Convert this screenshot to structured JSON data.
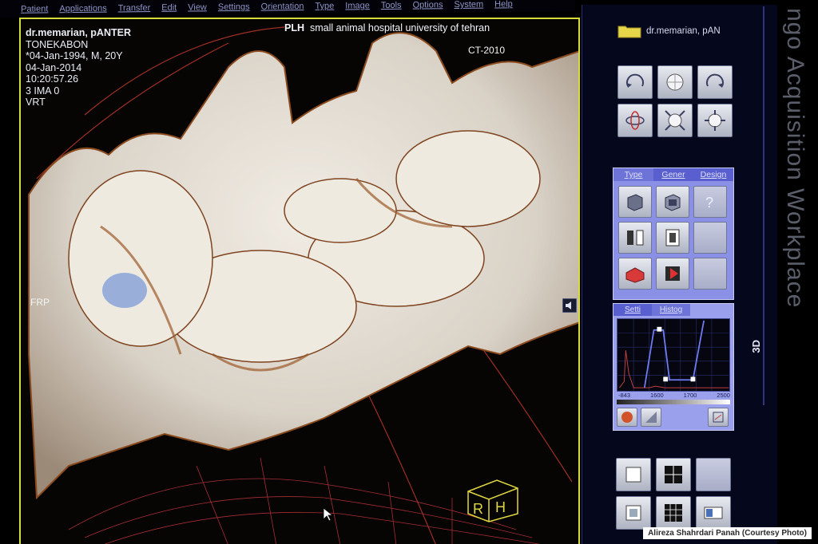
{
  "menu": [
    "Patient",
    "Applications",
    "Transfer",
    "Edit",
    "View",
    "Settings",
    "Orientation",
    "Type",
    "Image",
    "Tools",
    "Options",
    "System",
    "Help"
  ],
  "viewport": {
    "patient_name": "dr.memarian, pANTER",
    "location": "TONEKABON",
    "birth_info": "*04-Jan-1994, M, 20Y",
    "study_date": "04-Jan-2014",
    "study_time": "10:20:57.26",
    "image_info": "3 IMA 0",
    "render_mode": "VRT",
    "orientation_top": "PLH",
    "institution": "small animal hospital university of tehran",
    "scanner": "CT-2010",
    "orientation_left": "FRP",
    "cube_faces": [
      "R",
      "H"
    ]
  },
  "panel": {
    "folder_label": "dr.memarian, pAN",
    "render_tabs": [
      "Type",
      "Gener",
      "Design"
    ],
    "lut_tabs": [
      "Setti",
      "Histog"
    ],
    "lut_ticks": [
      "-843",
      "1600",
      "1700",
      "2500"
    ],
    "mode_label": "3D",
    "icons": {
      "nav": [
        "rotate-left-icon",
        "sphere-icon",
        "rotate-right-icon",
        "free-rotate-icon",
        "zoom-sphere-icon",
        "reset-view-icon"
      ],
      "render": [
        "volume-icon",
        "clip-volume-icon",
        "help-icon",
        "split-icon",
        "slab-icon",
        "color-volume-icon",
        "tag-icon"
      ],
      "bottom": [
        "layout-1-icon",
        "layout-grid-icon",
        "layout-3-icon",
        "layout-tile-icon",
        "layout-wide-icon"
      ]
    },
    "colors": {
      "accent": "#5a5fcf",
      "panel_bg": "#05071c",
      "viewport_border": "#d8dc3a"
    }
  },
  "window_title": "ngo Acquisition Workplace",
  "credit": "Alireza Shahrdari Panah (Courtesy Photo)"
}
